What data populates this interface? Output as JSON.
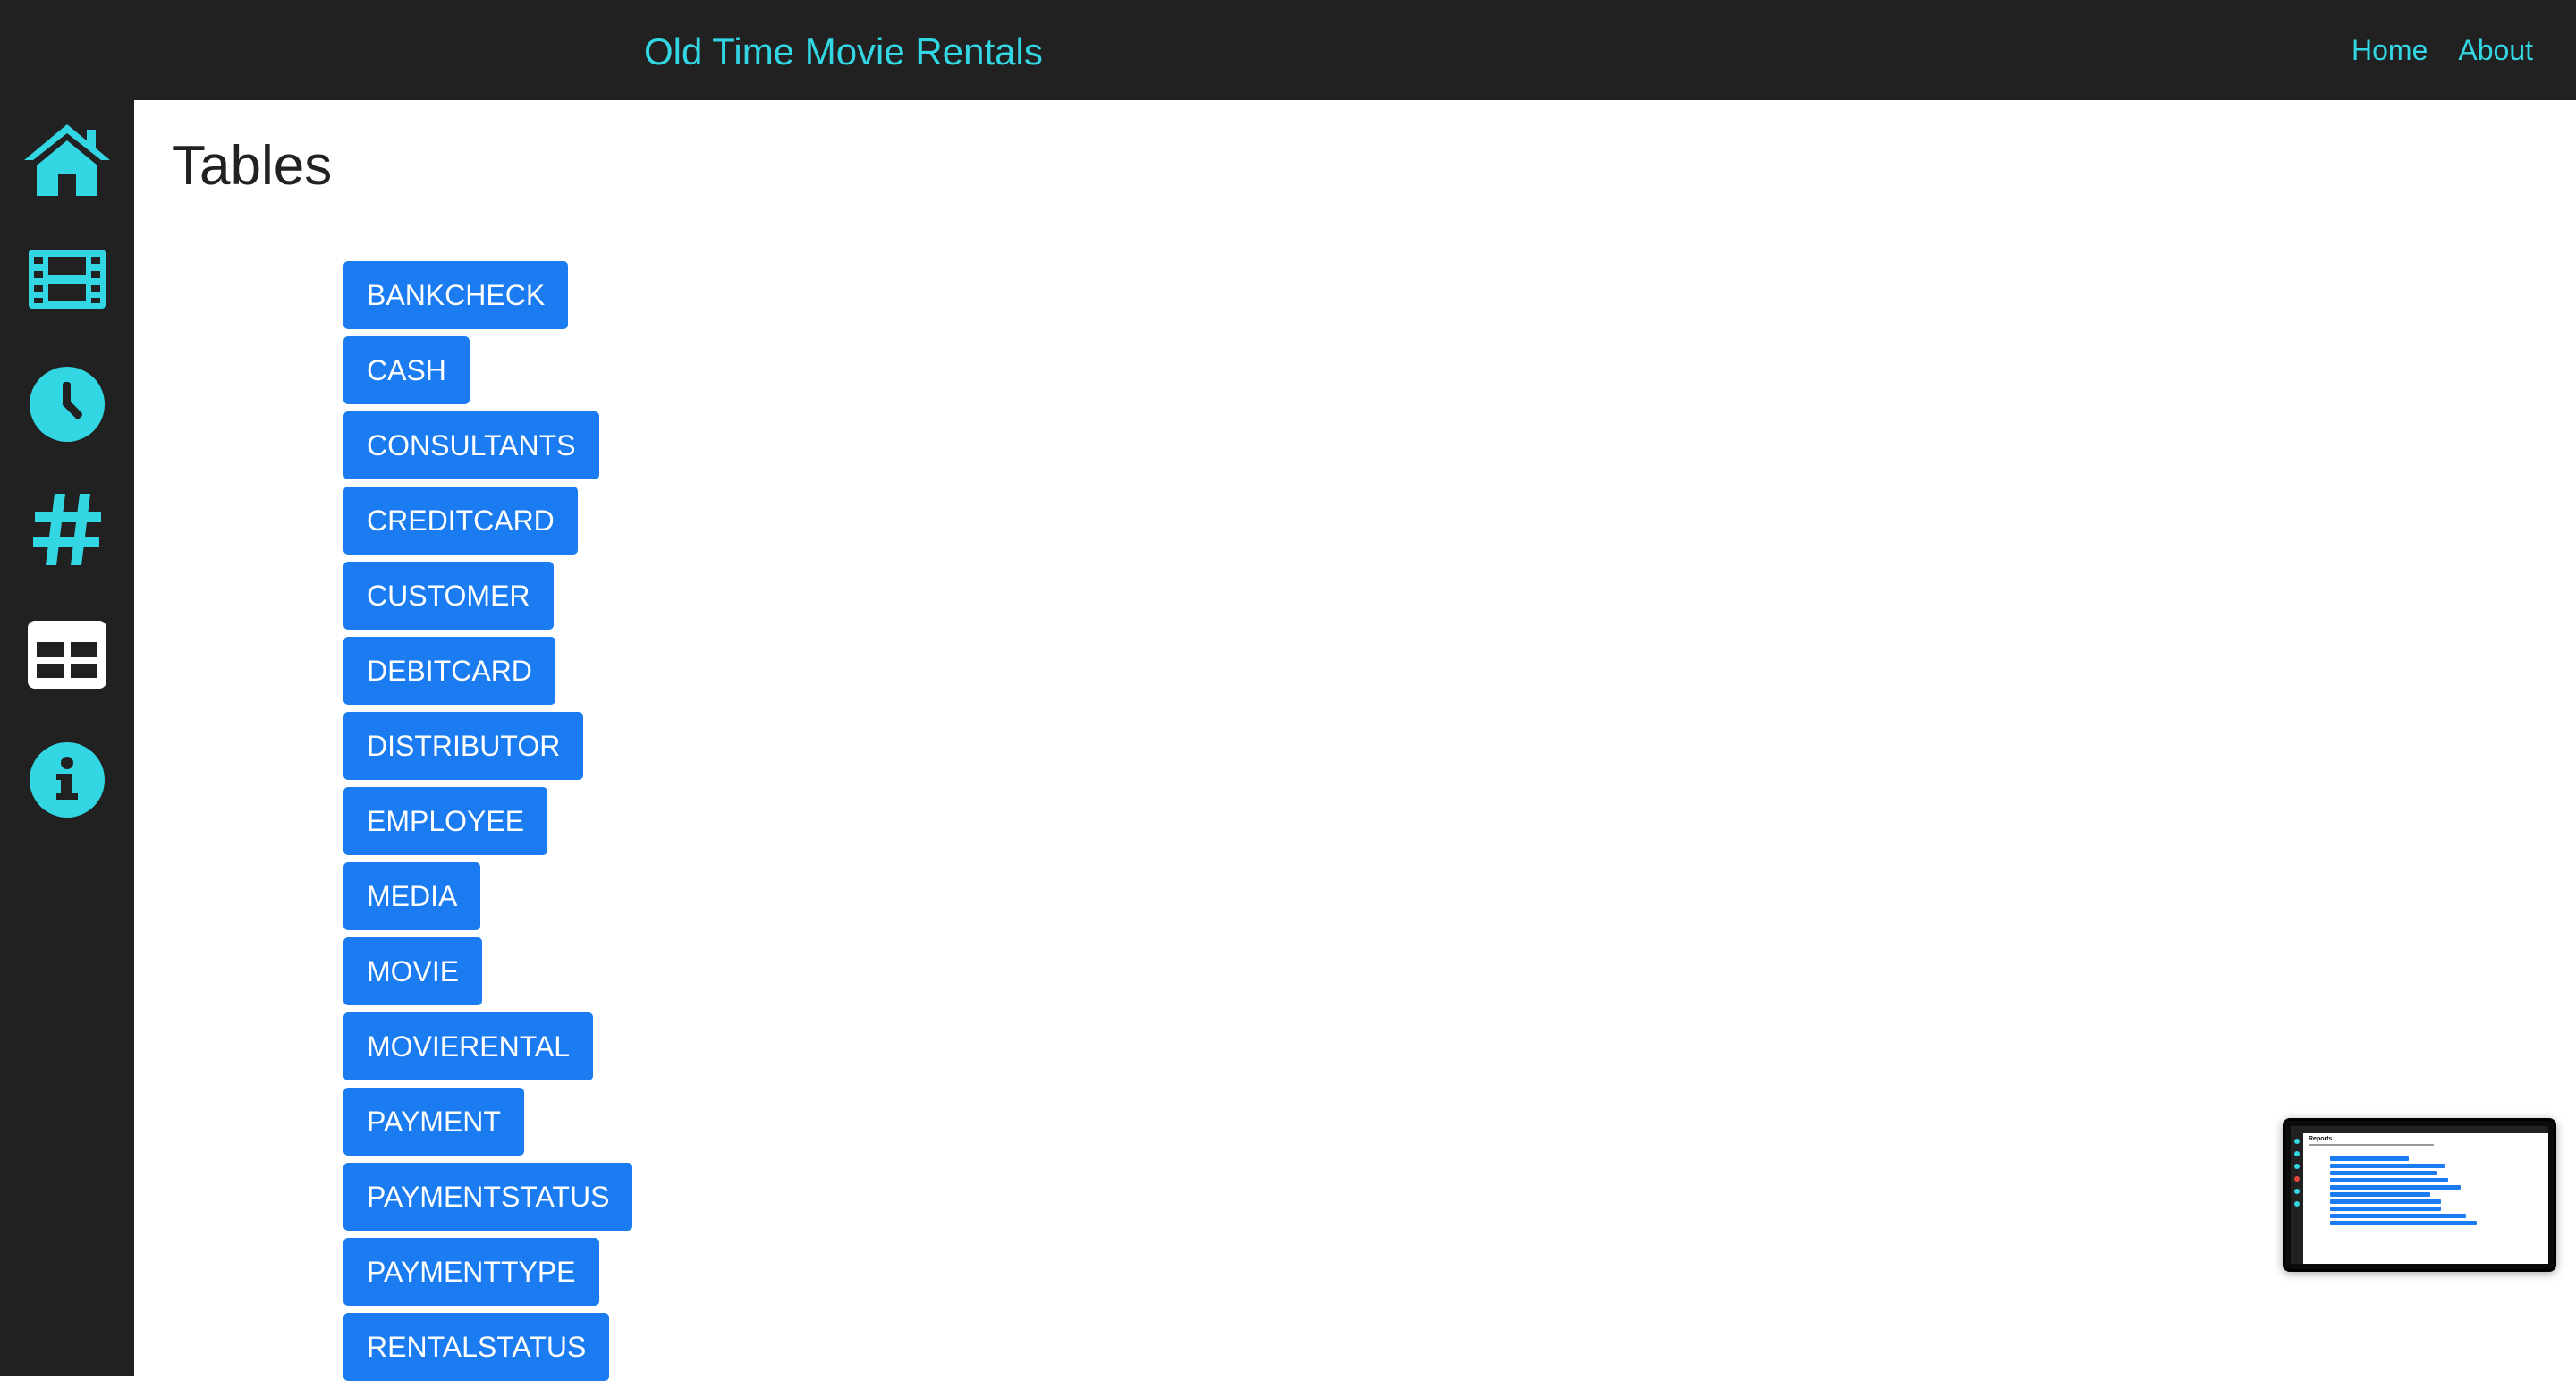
{
  "header": {
    "brand": "Old Time Movie Rentals",
    "nav": [
      "Home",
      "About"
    ]
  },
  "sidebar": {
    "icons": [
      "home-icon",
      "film-icon",
      "clock-icon",
      "hashtag-icon",
      "table-icon",
      "info-icon"
    ]
  },
  "page": {
    "title": "Tables"
  },
  "tables": [
    "BANKCHECK",
    "CASH",
    "CONSULTANTS",
    "CREDITCARD",
    "CUSTOMER",
    "DEBITCARD",
    "DISTRIBUTOR",
    "EMPLOYEE",
    "MEDIA",
    "MOVIE",
    "MOVIERENTAL",
    "PAYMENT",
    "PAYMENTSTATUS",
    "PAYMENTTYPE",
    "RENTALSTATUS"
  ],
  "thumbnail": {
    "title": "Reports"
  },
  "colors": {
    "accent": "#33d6e3",
    "button": "#1a7cf0",
    "chrome": "#212121"
  }
}
